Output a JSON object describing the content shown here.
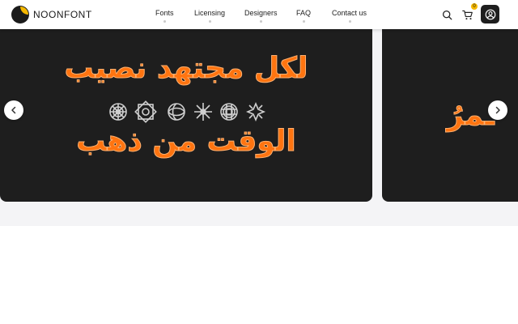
{
  "brand": {
    "name": "NOONFONT"
  },
  "nav": {
    "items": [
      "Fonts",
      "Licensing",
      "Designers",
      "FAQ",
      "Contact us"
    ]
  },
  "header": {
    "search_icon": "search-icon",
    "cart_icon": "cart-icon",
    "cart_count": "0",
    "account_icon": "user-icon"
  },
  "hero": {
    "slides": [
      {
        "line1": "لكل مجتهد نصيب",
        "line2": "الوقت من ذهب",
        "text_color": "#ff7410",
        "background": "#1e1e1e"
      },
      {
        "partial_text": "ـمرُ"
      }
    ],
    "prev_icon": "chevron-left-icon",
    "next_icon": "chevron-right-icon"
  },
  "colors": {
    "accent": "#f5b800",
    "slide_text": "#ff7410",
    "slide_bg": "#1e1e1e",
    "page_bg": "#f4f4f6"
  }
}
